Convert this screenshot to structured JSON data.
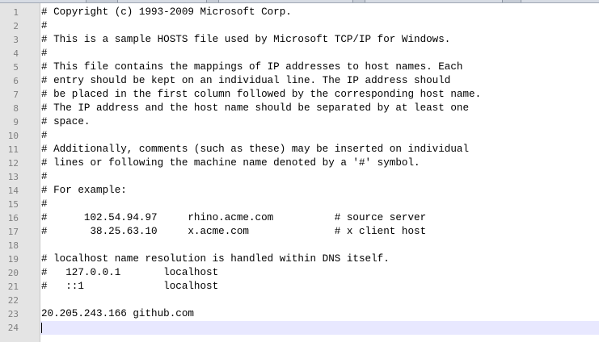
{
  "editor": {
    "current_line": 24,
    "line_numbers": [
      "1",
      "2",
      "3",
      "4",
      "5",
      "6",
      "7",
      "8",
      "9",
      "10",
      "11",
      "12",
      "13",
      "14",
      "15",
      "16",
      "17",
      "18",
      "19",
      "20",
      "21",
      "22",
      "23",
      "24"
    ],
    "lines": [
      "# Copyright (c) 1993-2009 Microsoft Corp.",
      "#",
      "# This is a sample HOSTS file used by Microsoft TCP/IP for Windows.",
      "#",
      "# This file contains the mappings of IP addresses to host names. Each",
      "# entry should be kept on an individual line. The IP address should",
      "# be placed in the first column followed by the corresponding host name.",
      "# The IP address and the host name should be separated by at least one",
      "# space.",
      "#",
      "# Additionally, comments (such as these) may be inserted on individual",
      "# lines or following the machine name denoted by a '#' symbol.",
      "#",
      "# For example:",
      "#",
      "#      102.54.94.97     rhino.acme.com          # source server",
      "#       38.25.63.10     x.acme.com              # x client host",
      "",
      "# localhost name resolution is handled within DNS itself.",
      "#   127.0.0.1       localhost",
      "#   ::1             localhost",
      "",
      "20.205.243.166 github.com",
      ""
    ]
  },
  "colors": {
    "gutter_bg": "#e4e4e4",
    "line_number": "#808080",
    "current_line_bg": "#e8e8ff",
    "text": "#000000"
  }
}
